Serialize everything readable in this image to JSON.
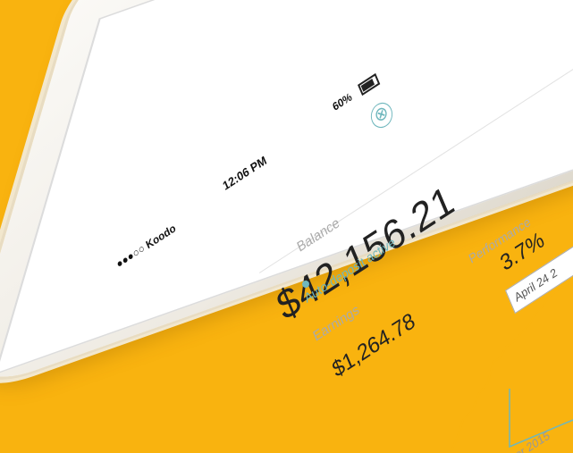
{
  "status_bar": {
    "carrier": "●●●○○ Koodo",
    "time": "12:06 PM",
    "battery": "60%"
  },
  "header": {
    "close_icon": "⊗"
  },
  "balance": {
    "label": "Balance",
    "value": "$42,156.21",
    "deposit_status": "Auto-deposit active",
    "accent": "#6fb7bd"
  },
  "earnings": {
    "label": "Earnings",
    "value": "$1,264.78"
  },
  "performance": {
    "label": "Performance",
    "value": "3.7%"
  },
  "chart": {
    "tooltip": "April 24 2",
    "axis_label": "ber 2015",
    "line_color": "#F9B30F"
  },
  "colors": {
    "background": "#F9B30F",
    "accent": "#6fb7bd"
  }
}
